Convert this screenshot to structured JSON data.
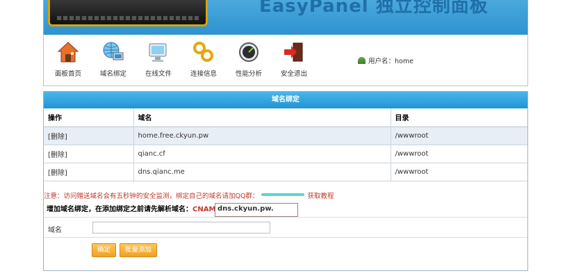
{
  "header": {
    "title": "EasyPanel 独立控制面板"
  },
  "toolbar": {
    "items": [
      {
        "label": "面板首页",
        "icon": "home-icon"
      },
      {
        "label": "域名绑定",
        "icon": "globe-computer-icon"
      },
      {
        "label": "在线文件",
        "icon": "monitor-file-icon"
      },
      {
        "label": "连接信息",
        "icon": "link-chain-icon"
      },
      {
        "label": "性能分析",
        "icon": "gauge-icon"
      },
      {
        "label": "安全退出",
        "icon": "exit-door-icon"
      }
    ],
    "user_label": "用户名：home"
  },
  "panel": {
    "title": "域名绑定",
    "columns": [
      "操作",
      "域名",
      "目录"
    ],
    "rows": [
      {
        "action": "[删除]",
        "domain": "home.free.ckyun.pw",
        "dir": "/wwwroot"
      },
      {
        "action": "[删除]",
        "domain": "qianc.cf",
        "dir": "/wwwroot"
      },
      {
        "action": "[删除]",
        "domain": "dns.qianc.me",
        "dir": "/wwwroot"
      }
    ],
    "notice_pre": "注意：访问赠送域名会有五秒钟的安全监测，绑定自己的域名请加QQ群：",
    "notice_post": "获取教程",
    "bind_text": "增加域名绑定，在添加绑定之前请先解析域名：",
    "cname_label": "CNAME",
    "cname_value": "dns.ckyun.pw.",
    "domain_field_label": "域名",
    "domain_field_value": "",
    "ok_button": "确定",
    "batch_button": "批量添加"
  },
  "colors": {
    "header_blue": "#2f93cf",
    "panel_header_blue": "#1f95d4",
    "button_orange": "#f0a023",
    "notice_red": "#c0392b"
  }
}
